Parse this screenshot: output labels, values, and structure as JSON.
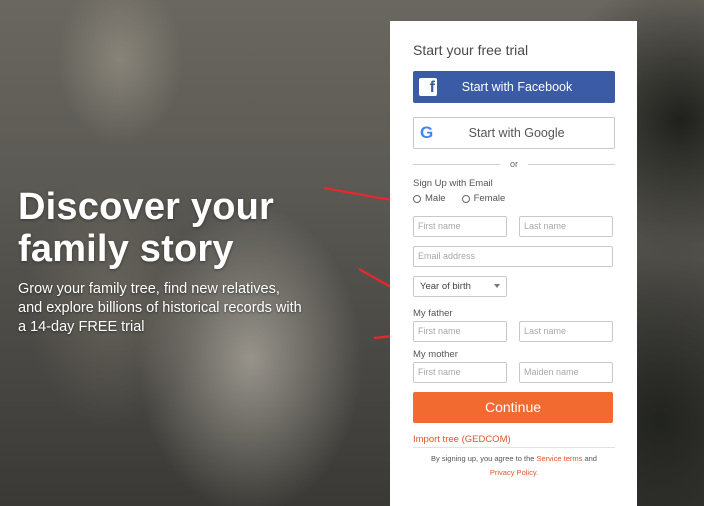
{
  "hero": {
    "title_line1": "Discover your",
    "title_line2": "family story",
    "subtitle_line1": "Grow your family tree, find new relatives,",
    "subtitle_line2": "and explore billions of historical records with",
    "subtitle_line3": "a 14-day FREE trial"
  },
  "form": {
    "title": "Start your free trial",
    "facebook_button": "Start with Facebook",
    "facebook_icon": "f",
    "google_button": "Start with Google",
    "google_icon": "G",
    "divider_text": "or",
    "signup_label": "Sign Up with Email",
    "gender_male": "Male",
    "gender_female": "Female",
    "first_name_placeholder": "First name",
    "last_name_placeholder": "Last name",
    "email_placeholder": "Email address",
    "year_of_birth": "Year of birth",
    "father_label": "My father",
    "father_first_placeholder": "First name",
    "father_last_placeholder": "Last name",
    "mother_label": "My mother",
    "mother_first_placeholder": "First name",
    "mother_maiden_placeholder": "Maiden name",
    "continue_button": "Continue",
    "import_link": "Import tree (GEDCOM)",
    "terms_prefix": "By signing up, you agree to the",
    "terms_service": "Service terms",
    "terms_and": "and",
    "terms_privacy": "Privacy Policy."
  },
  "colors": {
    "facebook": "#3b5ba7",
    "accent_orange": "#f36a31",
    "link_orange": "#e2542a",
    "arrow_red": "#e8282b"
  }
}
